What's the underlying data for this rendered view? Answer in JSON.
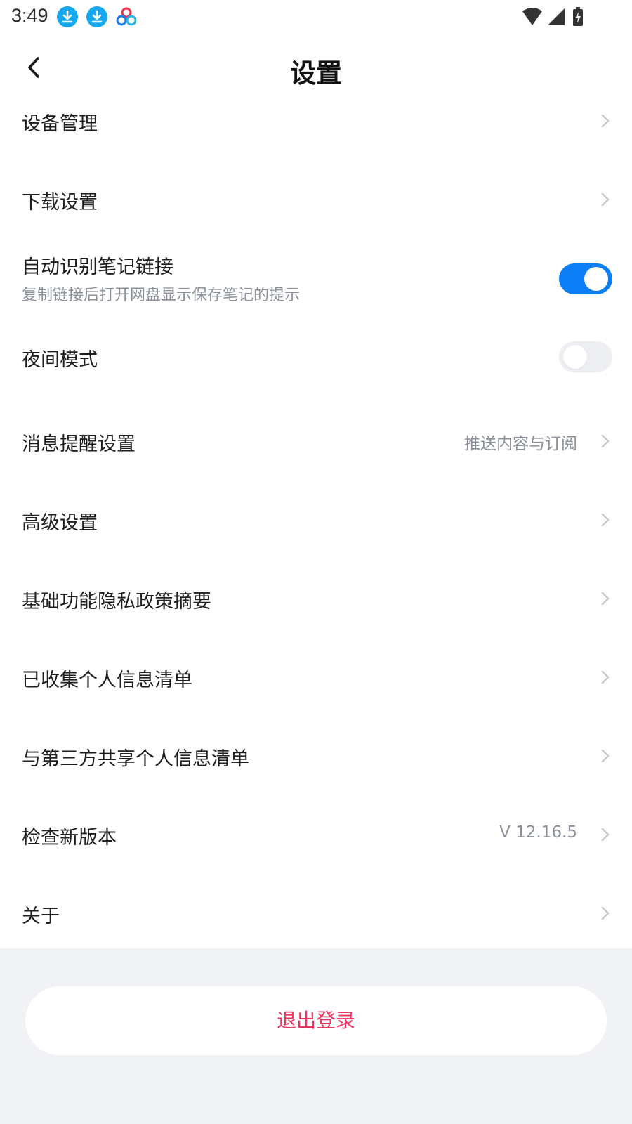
{
  "status_bar": {
    "time": "3:49",
    "icons_left": [
      "download-notification-icon",
      "download-notification-icon",
      "baidu-netdisk-icon"
    ],
    "icons_right": [
      "wifi-icon",
      "signal-icon",
      "battery-charging-icon"
    ]
  },
  "header": {
    "title": "设置",
    "back_icon": "chevron-left-icon"
  },
  "settings": {
    "device_management": "设备管理",
    "download_settings": "下载设置",
    "auto_detect_links": {
      "label": "自动识别笔记链接",
      "description": "复制链接后打开网盘显示保存笔记的提示",
      "enabled": true
    },
    "night_mode": {
      "label": "夜间模式",
      "enabled": false
    },
    "notification_settings": {
      "label": "消息提醒设置",
      "value": "推送内容与订阅"
    },
    "advanced_settings": "高级设置",
    "privacy_summary": "基础功能隐私政策摘要",
    "collected_info": "已收集个人信息清单",
    "third_party_info": "与第三方共享个人信息清单",
    "check_version": {
      "label": "检查新版本",
      "value": "V 12.16.5"
    },
    "about": "关于"
  },
  "logout": {
    "label": "退出登录"
  },
  "colors": {
    "accent": "#0b7ef5",
    "danger": "#f0345e",
    "secondary_text": "#8a8f99",
    "bottom_background": "#f1f2f6"
  }
}
